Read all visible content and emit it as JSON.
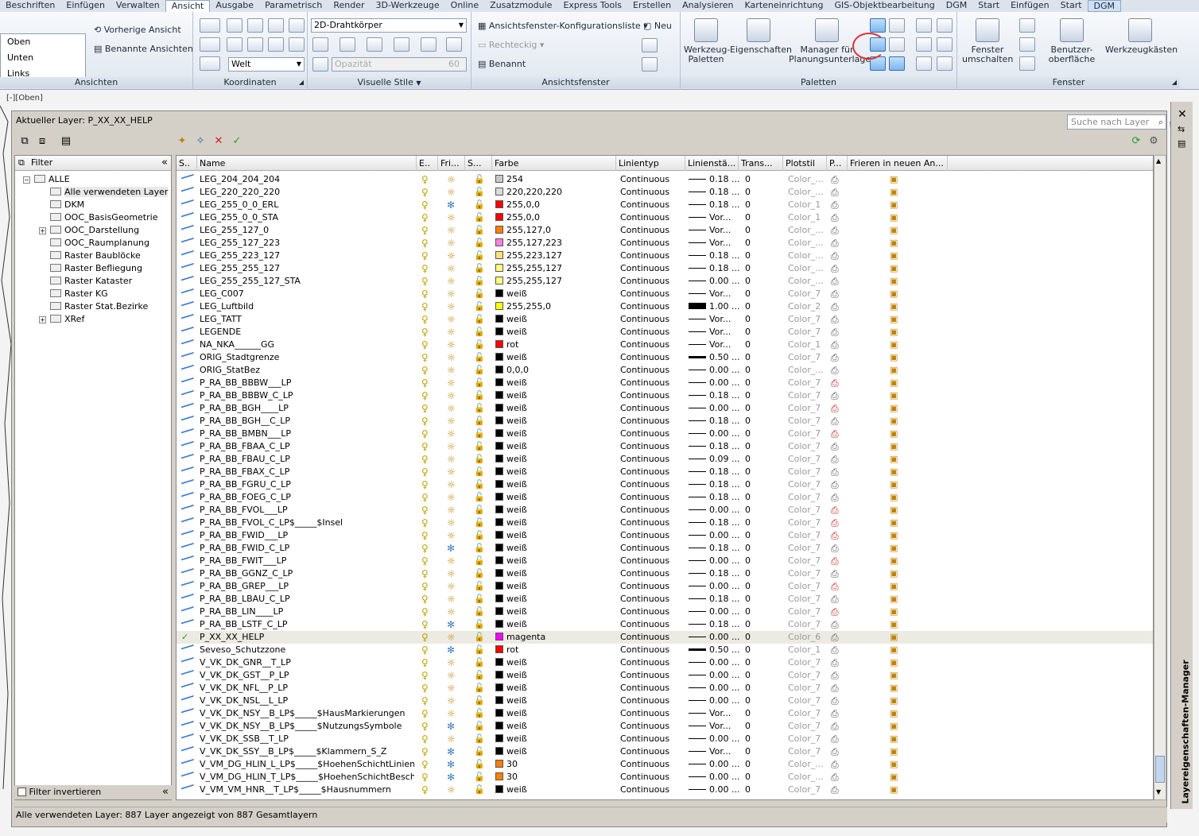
{
  "menu": [
    "Beschriften",
    "Einfügen",
    "Verwalten",
    "Ansicht",
    "Ausgabe",
    "Parametrisch",
    "Render",
    "3D-Werkzeuge",
    "Online",
    "Zusatzmodule",
    "Express Tools",
    "Erstellen",
    "Analysieren",
    "Karteneinrichtung",
    "GIS-Objektbearbeitung",
    "DGM",
    "Start",
    "Einfügen",
    "Start",
    "DGM"
  ],
  "ribbon": {
    "views": {
      "items": [
        "Oben",
        "Unten",
        "Links"
      ],
      "prev": "Vorherige Ansicht",
      "named": "Benannte Ansichten",
      "label": "Ansichten"
    },
    "coords": {
      "world": "Welt",
      "label": "Koordinaten"
    },
    "visual": {
      "style": "2D-Drahtkörper",
      "opacity": "Opazität",
      "opacity_val": "60",
      "label": "Visuelle Stile"
    },
    "viewports": {
      "config": "Ansichtsfenster-Konfigurationsliste",
      "rect": "Rechteckig",
      "named": "Benannt",
      "new": "Neu",
      "label": "Ansichtsfenster"
    },
    "palettes": {
      "tools": "Werkzeug-\nPaletten",
      "props": "Eigenschaften",
      "sheetset": "Manager für\nPlanungsunterlagen",
      "label": "Paletten"
    },
    "window": {
      "switch": "Fenster\numschalten",
      "ui": "Benutzer-\noberfläche",
      "toolbars": "Werkzeugkästen",
      "label": "Fenster"
    }
  },
  "dwg_tab": "[-][Oben]",
  "current_layer": "Aktueller Layer: P_XX_XX_HELP",
  "search_placeholder": "Suche nach Layer",
  "filter": {
    "header": "Filter",
    "items": [
      "ALLE",
      "Alle verwendeten Layer",
      "DKM",
      "OOC_BasisGeometrie",
      "OOC_Darstellung",
      "OOC_Raumplanung",
      "Raster Baublöcke",
      "Raster Befliegung",
      "Raster Kataster",
      "Raster KG",
      "Raster Stat.Bezirke",
      "XRef"
    ],
    "invert": "Filter invertieren"
  },
  "columns": [
    "S..",
    "Name",
    "E..",
    "Fri...",
    "S...",
    "Farbe",
    "Linientyp",
    "Linienstä...",
    "Trans...",
    "Plotstil",
    "P...",
    "Frieren in neuen An..."
  ],
  "layers": [
    {
      "name": "LEG_204_204_204",
      "color": "254",
      "hex": "#c8c8c8",
      "lt": "Continuous",
      "lw": "0.18 ...",
      "t": "0",
      "ps": "Color_...",
      "fz": false
    },
    {
      "name": "LEG_220_220_220",
      "color": "220,220,220",
      "hex": "#dcdcdc",
      "lt": "Continuous",
      "lw": "0.18 ...",
      "t": "0",
      "ps": "Color_...",
      "fz": false
    },
    {
      "name": "LEG_255_0_0_ERL",
      "color": "255,0,0",
      "hex": "#ff0000",
      "lt": "Continuous",
      "lw": "0.18 ...",
      "t": "0",
      "ps": "Color_1",
      "fz": true
    },
    {
      "name": "LEG_255_0_0_STA",
      "color": "255,0,0",
      "hex": "#ff0000",
      "lt": "Continuous",
      "lw": "Vor...",
      "t": "0",
      "ps": "Color_1",
      "fz": false
    },
    {
      "name": "LEG_255_127_0",
      "color": "255,127,0",
      "hex": "#ff7f00",
      "lt": "Continuous",
      "lw": "Vor...",
      "t": "0",
      "ps": "Color_...",
      "fz": false
    },
    {
      "name": "LEG_255_127_223",
      "color": "255,127,223",
      "hex": "#ff7fdf",
      "lt": "Continuous",
      "lw": "Vor...",
      "t": "0",
      "ps": "Color_...",
      "fz": false
    },
    {
      "name": "LEG_255_223_127",
      "color": "255,223,127",
      "hex": "#ffdf7f",
      "lt": "Continuous",
      "lw": "0.18 ...",
      "t": "0",
      "ps": "Color_...",
      "fz": false
    },
    {
      "name": "LEG_255_255_127",
      "color": "255,255,127",
      "hex": "#ffff7f",
      "lt": "Continuous",
      "lw": "0.18 ...",
      "t": "0",
      "ps": "Color_...",
      "fz": false
    },
    {
      "name": "LEG_255_255_127_STA",
      "color": "255,255,127",
      "hex": "#ffff7f",
      "lt": "Continuous",
      "lw": "0.00 ...",
      "t": "0",
      "ps": "Color_...",
      "fz": false
    },
    {
      "name": "LEG_C007",
      "color": "weiß",
      "hex": "#000000",
      "lt": "Continuous",
      "lw": "Vor...",
      "t": "0",
      "ps": "Color_7",
      "fz": false
    },
    {
      "name": "LEG_Luftbild",
      "color": "255,255,0",
      "hex": "#ffff00",
      "lt": "Continuous",
      "lw": "1.00 ...",
      "t": "0",
      "ps": "Color_2",
      "fz": false,
      "lwt": "xthick"
    },
    {
      "name": "LEG_TATT",
      "color": "weiß",
      "hex": "#000000",
      "lt": "Continuous",
      "lw": "Vor...",
      "t": "0",
      "ps": "Color_7",
      "fz": false
    },
    {
      "name": "LEGENDE",
      "color": "weiß",
      "hex": "#000000",
      "lt": "Continuous",
      "lw": "Vor...",
      "t": "0",
      "ps": "Color_7",
      "fz": false
    },
    {
      "name": "NA_NKA______GG",
      "color": "rot",
      "hex": "#ff0000",
      "lt": "Continuous",
      "lw": "Vor...",
      "t": "0",
      "ps": "Color_1",
      "fz": false
    },
    {
      "name": "ORIG_Stadtgrenze",
      "color": "weiß",
      "hex": "#000000",
      "lt": "Continuous",
      "lw": "0.50 ...",
      "t": "0",
      "ps": "Color_7",
      "fz": false,
      "lwt": "thick"
    },
    {
      "name": "ORIG_StatBez",
      "color": "0,0,0",
      "hex": "#000000",
      "lt": "Continuous",
      "lw": "0.00 ...",
      "t": "0",
      "ps": "Color_...",
      "fz": false
    },
    {
      "name": "P_RA_BB_BBBW___LP",
      "color": "weiß",
      "hex": "#000000",
      "lt": "Continuous",
      "lw": "0.00 ...",
      "t": "0",
      "ps": "Color_7",
      "fz": false,
      "np": true
    },
    {
      "name": "P_RA_BB_BBBW_C_LP",
      "color": "weiß",
      "hex": "#000000",
      "lt": "Continuous",
      "lw": "0.18 ...",
      "t": "0",
      "ps": "Color_7",
      "fz": false
    },
    {
      "name": "P_RA_BB_BGH____LP",
      "color": "weiß",
      "hex": "#000000",
      "lt": "Continuous",
      "lw": "0.00 ...",
      "t": "0",
      "ps": "Color_7",
      "fz": false,
      "np": true
    },
    {
      "name": "P_RA_BB_BGH__C_LP",
      "color": "weiß",
      "hex": "#000000",
      "lt": "Continuous",
      "lw": "0.18 ...",
      "t": "0",
      "ps": "Color_7",
      "fz": false
    },
    {
      "name": "P_RA_BB_BMBN___LP",
      "color": "weiß",
      "hex": "#000000",
      "lt": "Continuous",
      "lw": "0.00 ...",
      "t": "0",
      "ps": "Color_7",
      "fz": false,
      "np": true
    },
    {
      "name": "P_RA_BB_FBAA_C_LP",
      "color": "weiß",
      "hex": "#000000",
      "lt": "Continuous",
      "lw": "0.18 ...",
      "t": "0",
      "ps": "Color_7",
      "fz": false
    },
    {
      "name": "P_RA_BB_FBAU_C_LP",
      "color": "weiß",
      "hex": "#000000",
      "lt": "Continuous",
      "lw": "0.09 ...",
      "t": "0",
      "ps": "Color_7",
      "fz": false
    },
    {
      "name": "P_RA_BB_FBAX_C_LP",
      "color": "weiß",
      "hex": "#000000",
      "lt": "Continuous",
      "lw": "0.18 ...",
      "t": "0",
      "ps": "Color_7",
      "fz": false
    },
    {
      "name": "P_RA_BB_FGRU_C_LP",
      "color": "weiß",
      "hex": "#000000",
      "lt": "Continuous",
      "lw": "0.18 ...",
      "t": "0",
      "ps": "Color_7",
      "fz": false
    },
    {
      "name": "P_RA_BB_FOEG_C_LP",
      "color": "weiß",
      "hex": "#000000",
      "lt": "Continuous",
      "lw": "0.18 ...",
      "t": "0",
      "ps": "Color_7",
      "fz": false
    },
    {
      "name": "P_RA_BB_FVOL___LP",
      "color": "weiß",
      "hex": "#000000",
      "lt": "Continuous",
      "lw": "0.00 ...",
      "t": "0",
      "ps": "Color_7",
      "fz": false,
      "np": true
    },
    {
      "name": "P_RA_BB_FVOL_C_LP$_____$Insel",
      "color": "weiß",
      "hex": "#000000",
      "lt": "Continuous",
      "lw": "0.18 ...",
      "t": "0",
      "ps": "Color_7",
      "fz": false,
      "np": true
    },
    {
      "name": "P_RA_BB_FWID___LP",
      "color": "weiß",
      "hex": "#000000",
      "lt": "Continuous",
      "lw": "0.00 ...",
      "t": "0",
      "ps": "Color_7",
      "fz": false,
      "np": true
    },
    {
      "name": "P_RA_BB_FWID_C_LP",
      "color": "weiß",
      "hex": "#000000",
      "lt": "Continuous",
      "lw": "0.18 ...",
      "t": "0",
      "ps": "Color_7",
      "fz": true
    },
    {
      "name": "P_RA_BB_FWIT___LP",
      "color": "weiß",
      "hex": "#000000",
      "lt": "Continuous",
      "lw": "0.00 ...",
      "t": "0",
      "ps": "Color_7",
      "fz": false,
      "np": true
    },
    {
      "name": "P_RA_BB_GGNZ_C_LP",
      "color": "weiß",
      "hex": "#000000",
      "lt": "Continuous",
      "lw": "0.18 ...",
      "t": "0",
      "ps": "Color_7",
      "fz": false
    },
    {
      "name": "P_RA_BB_GREP___LP",
      "color": "weiß",
      "hex": "#000000",
      "lt": "Continuous",
      "lw": "0.00 ...",
      "t": "0",
      "ps": "Color_7",
      "fz": false,
      "np": true
    },
    {
      "name": "P_RA_BB_LBAU_C_LP",
      "color": "weiß",
      "hex": "#000000",
      "lt": "Continuous",
      "lw": "0.18 ...",
      "t": "0",
      "ps": "Color_7",
      "fz": false
    },
    {
      "name": "P_RA_BB_LIN____LP",
      "color": "weiß",
      "hex": "#000000",
      "lt": "Continuous",
      "lw": "0.00 ...",
      "t": "0",
      "ps": "Color_7",
      "fz": false,
      "np": true
    },
    {
      "name": "P_RA_BB_LSTF_C_LP",
      "color": "weiß",
      "hex": "#000000",
      "lt": "Continuous",
      "lw": "0.18 ...",
      "t": "0",
      "ps": "Color_7",
      "fz": true
    },
    {
      "name": "P_XX_XX_HELP",
      "color": "magenta",
      "hex": "#ff00ff",
      "lt": "Continuous",
      "lw": "0.00 ...",
      "t": "0",
      "ps": "Color_6",
      "fz": false,
      "cur": true
    },
    {
      "name": "Seveso_Schutzzone",
      "color": "rot",
      "hex": "#ff0000",
      "lt": "Continuous",
      "lw": "0.50 ...",
      "t": "0",
      "ps": "Color_1",
      "fz": true,
      "lwt": "thick"
    },
    {
      "name": "V_VK_DK_GNR__T_LP",
      "color": "weiß",
      "hex": "#000000",
      "lt": "Continuous",
      "lw": "0.00 ...",
      "t": "0",
      "ps": "Color_7",
      "fz": false
    },
    {
      "name": "V_VK_DK_GST__P_LP",
      "color": "weiß",
      "hex": "#000000",
      "lt": "Continuous",
      "lw": "0.00 ...",
      "t": "0",
      "ps": "Color_7",
      "fz": false
    },
    {
      "name": "V_VK_DK_NFL__P_LP",
      "color": "weiß",
      "hex": "#000000",
      "lt": "Continuous",
      "lw": "0.00 ...",
      "t": "0",
      "ps": "Color_7",
      "fz": false
    },
    {
      "name": "V_VK_DK_NSL__L_LP",
      "color": "weiß",
      "hex": "#000000",
      "lt": "Continuous",
      "lw": "0.00 ...",
      "t": "0",
      "ps": "Color_7",
      "fz": false
    },
    {
      "name": "V_VK_DK_NSY__B_LP$_____$HausMarkierungen",
      "color": "weiß",
      "hex": "#000000",
      "lt": "Continuous",
      "lw": "Vor...",
      "t": "0",
      "ps": "Color_7",
      "fz": false
    },
    {
      "name": "V_VK_DK_NSY__B_LP$_____$NutzungsSymbole",
      "color": "weiß",
      "hex": "#000000",
      "lt": "Continuous",
      "lw": "Vor...",
      "t": "0",
      "ps": "Color_7",
      "fz": true
    },
    {
      "name": "V_VK_DK_SSB__T_LP",
      "color": "weiß",
      "hex": "#000000",
      "lt": "Continuous",
      "lw": "0.00 ...",
      "t": "0",
      "ps": "Color_7",
      "fz": false
    },
    {
      "name": "V_VK_DK_SSY__B_LP$_____$Klammern_S_Z",
      "color": "weiß",
      "hex": "#000000",
      "lt": "Continuous",
      "lw": "Vor...",
      "t": "0",
      "ps": "Color_7",
      "fz": true
    },
    {
      "name": "V_VM_DG_HLIN_L_LP$_____$HoehenSchichtLinien",
      "color": "30",
      "hex": "#ff7f00",
      "lt": "Continuous",
      "lw": "0.00 ...",
      "t": "0",
      "ps": "Color_...",
      "fz": true
    },
    {
      "name": "V_VM_DG_HLIN_T_LP$_____$HoehenSchichtBesch...",
      "color": "30",
      "hex": "#ff7f00",
      "lt": "Continuous",
      "lw": "0.00 ...",
      "t": "0",
      "ps": "Color_...",
      "fz": true
    },
    {
      "name": "V_VM_VM_HNR__T_LP$_____$Hausnummern",
      "color": "weiß",
      "hex": "#000000",
      "lt": "Continuous",
      "lw": "0.00 ...",
      "t": "0",
      "ps": "Color_7",
      "fz": false
    }
  ],
  "status": "Alle verwendeten Layer: 887 Layer angezeigt von 887 Gesamtlayern",
  "palette_title": "Layereigenschaften-Manager"
}
